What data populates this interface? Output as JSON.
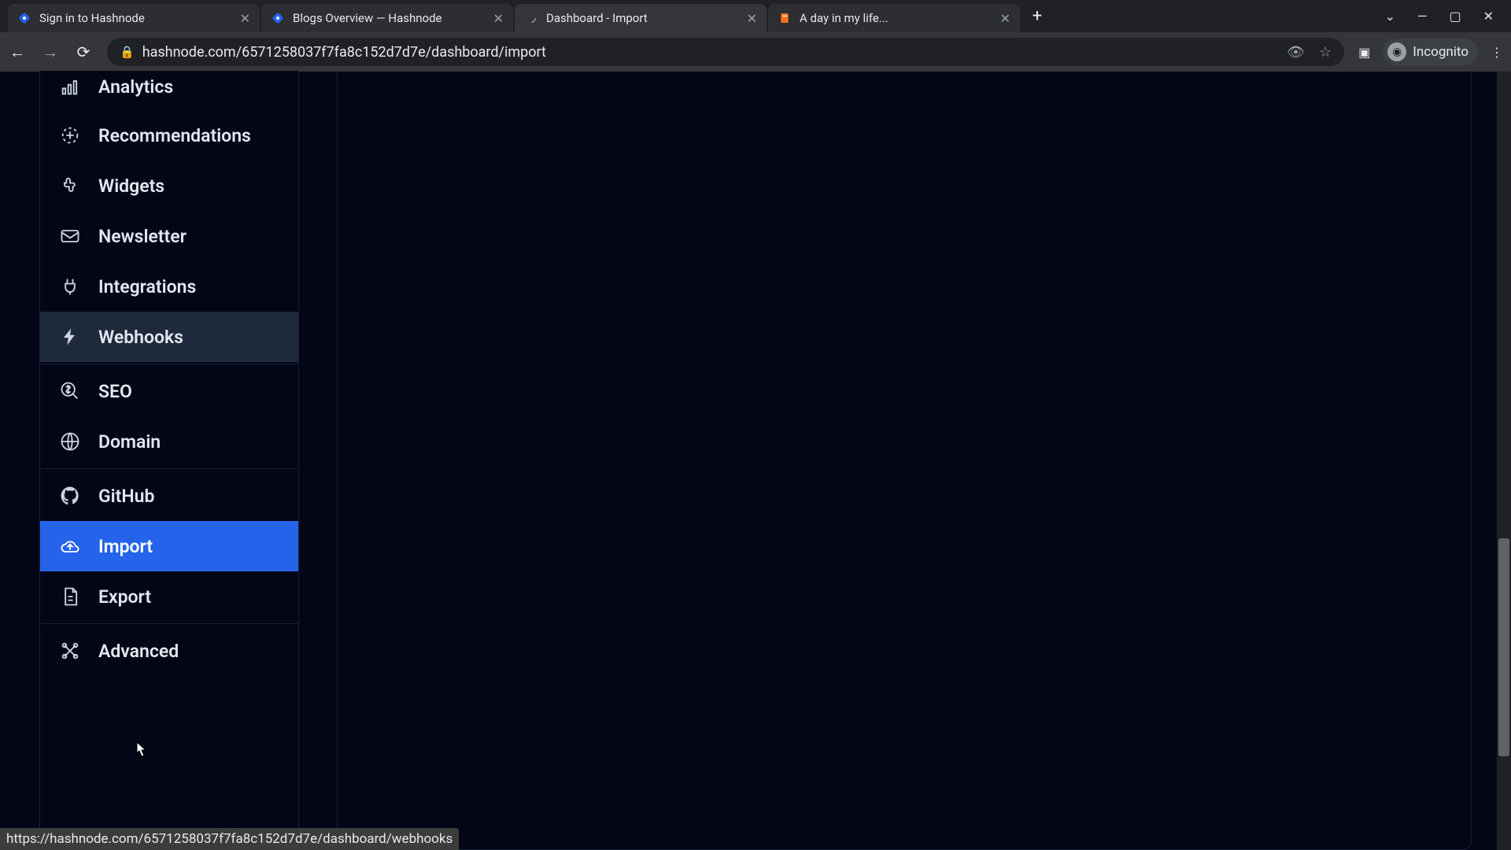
{
  "browser": {
    "tabs": [
      {
        "title": "Sign in to Hashnode",
        "active": false,
        "favicon": "hashnode"
      },
      {
        "title": "Blogs Overview — Hashnode",
        "active": false,
        "favicon": "hashnode"
      },
      {
        "title": "Dashboard - Import",
        "active": true,
        "favicon": "spinner"
      },
      {
        "title": "A day in my life...",
        "active": false,
        "favicon": "doc"
      }
    ],
    "url": "hashnode.com/6571258037f7fa8c152d7d7e/dashboard/import",
    "incognito_label": "Incognito"
  },
  "sidebar": {
    "groups": [
      [
        {
          "id": "analytics",
          "label": "Analytics",
          "icon": "analytics",
          "partial": true
        },
        {
          "id": "recommendations",
          "label": "Recommendations",
          "icon": "sparkle"
        },
        {
          "id": "widgets",
          "label": "Widgets",
          "icon": "puzzle"
        },
        {
          "id": "newsletter",
          "label": "Newsletter",
          "icon": "mail"
        },
        {
          "id": "integrations",
          "label": "Integrations",
          "icon": "plug"
        },
        {
          "id": "webhooks",
          "label": "Webhooks",
          "icon": "bolt",
          "state": "hover"
        }
      ],
      [
        {
          "id": "seo",
          "label": "SEO",
          "icon": "search-dollar"
        },
        {
          "id": "domain",
          "label": "Domain",
          "icon": "globe"
        }
      ],
      [
        {
          "id": "github",
          "label": "GitHub",
          "icon": "github"
        },
        {
          "id": "import",
          "label": "Import",
          "icon": "cloud-up",
          "state": "active"
        },
        {
          "id": "export",
          "label": "Export",
          "icon": "file"
        }
      ],
      [
        {
          "id": "advanced",
          "label": "Advanced",
          "icon": "tools"
        }
      ]
    ]
  },
  "status_url": "https://hashnode.com/6571258037f7fa8c152d7d7e/dashboard/webhooks"
}
